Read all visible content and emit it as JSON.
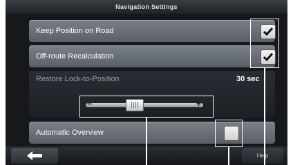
{
  "window": {
    "title": "Navigation Settings"
  },
  "settings": {
    "keep_position": {
      "label": "Keep Position on Road",
      "checked": true
    },
    "offroute": {
      "label": "Off-route Recalculation",
      "checked": true
    },
    "restore_lock": {
      "label": "Restore Lock-to-Position",
      "value": "30 sec",
      "slider_level": 0.4
    },
    "auto_overview": {
      "label": "Automatic Overview",
      "checked": false
    }
  },
  "bottom": {
    "back_icon": "arrow-left-icon",
    "help_label": "Help"
  },
  "slider": {
    "minus_glyph": "−",
    "plus_glyph": "+"
  }
}
